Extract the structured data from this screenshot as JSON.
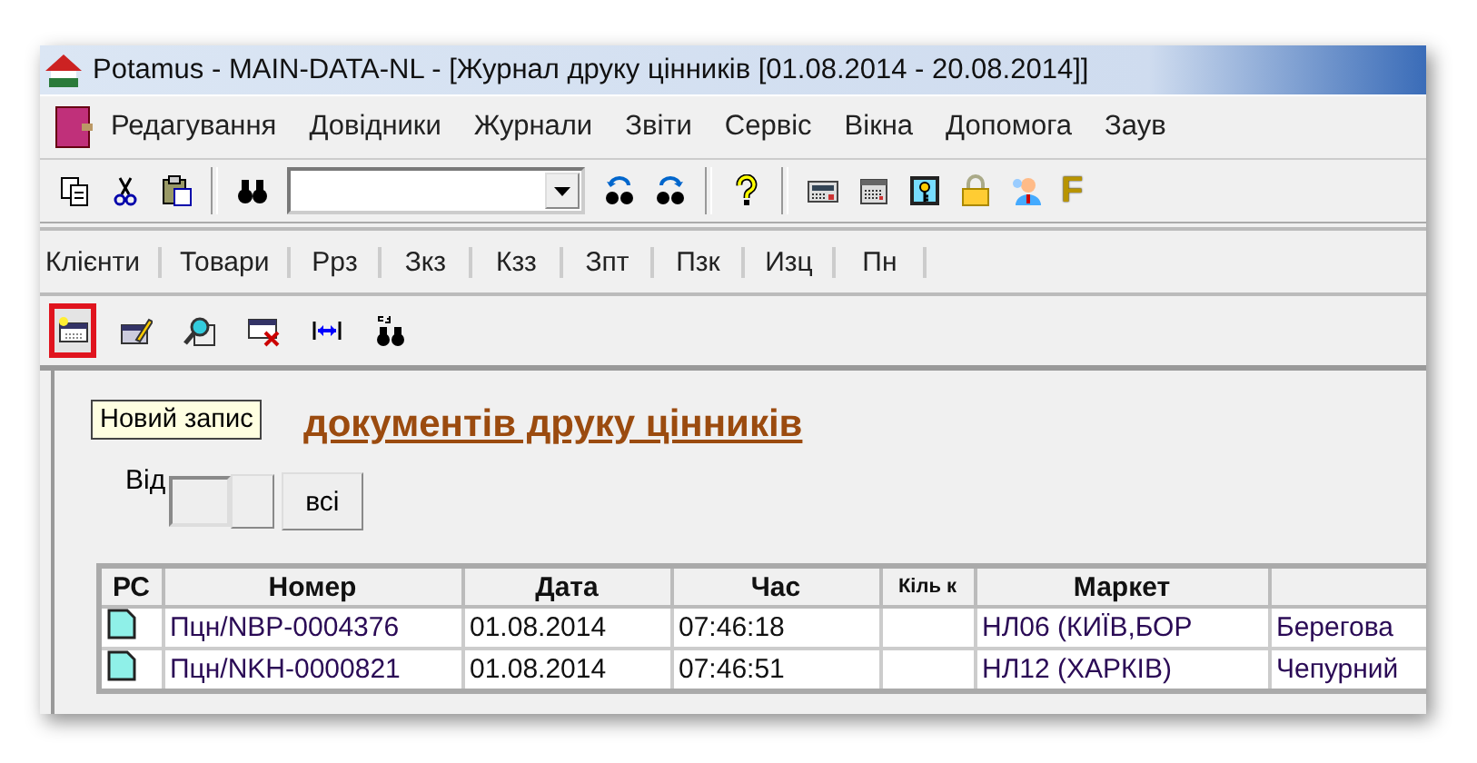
{
  "window": {
    "title": "Potamus - MAIN-DATA-NL - [Журнал друку цінників  [01.08.2014 - 20.08.2014]]"
  },
  "menu": [
    "Редагування",
    "Довідники",
    "Журнали",
    "Звіти",
    "Сервіс",
    "Вікна",
    "Допомога",
    "Заув"
  ],
  "toolbar": [
    {
      "kind": "copy"
    },
    {
      "kind": "cut"
    },
    {
      "kind": "paste"
    },
    {
      "kind": "separator"
    },
    {
      "kind": "find"
    },
    {
      "kind": "combo"
    },
    {
      "kind": "find-prev"
    },
    {
      "kind": "find-next"
    },
    {
      "kind": "separator"
    },
    {
      "kind": "help"
    },
    {
      "kind": "separator"
    },
    {
      "kind": "calculator"
    },
    {
      "kind": "calendar"
    },
    {
      "kind": "key"
    },
    {
      "kind": "lock"
    },
    {
      "kind": "user"
    },
    {
      "kind": "letter",
      "text": "F"
    }
  ],
  "tabs": [
    {
      "label": "Клієнти"
    },
    {
      "label": "Товари"
    },
    {
      "label": "Рpз"
    },
    {
      "label": "Зкз"
    },
    {
      "label": "Кзз"
    },
    {
      "label": "Зпт"
    },
    {
      "label": "Пзк"
    },
    {
      "label": "Изц"
    },
    {
      "label": "Пн"
    }
  ],
  "record_tools": [
    {
      "kind": "new",
      "highlighted": true
    },
    {
      "kind": "edit",
      "highlighted": false
    },
    {
      "kind": "view",
      "highlighted": false
    },
    {
      "kind": "delete",
      "highlighted": false
    },
    {
      "kind": "fit",
      "highlighted": false
    },
    {
      "kind": "search",
      "highlighted": false
    }
  ],
  "tooltip": "Новий запис",
  "journal": {
    "heading": "документів друку цінників",
    "from_label": "Від",
    "all_button": "всі"
  },
  "table": {
    "columns": [
      "РС",
      "Номер",
      "Дата",
      "Час",
      "Кіль к",
      "Маркет"
    ],
    "rows": [
      {
        "number": "Пцн/NBP-0004376",
        "date": "01.08.2014",
        "time": "07:46:18",
        "market": "НЛ06 (КИЇВ,БОР",
        "column_7": "Берегова"
      },
      {
        "number": "Пцн/NKH-0000821",
        "date": "01.08.2014",
        "time": "07:46:51",
        "market": "НЛ12 (ХАРКІВ)",
        "column_7": "Чепурний"
      }
    ]
  }
}
